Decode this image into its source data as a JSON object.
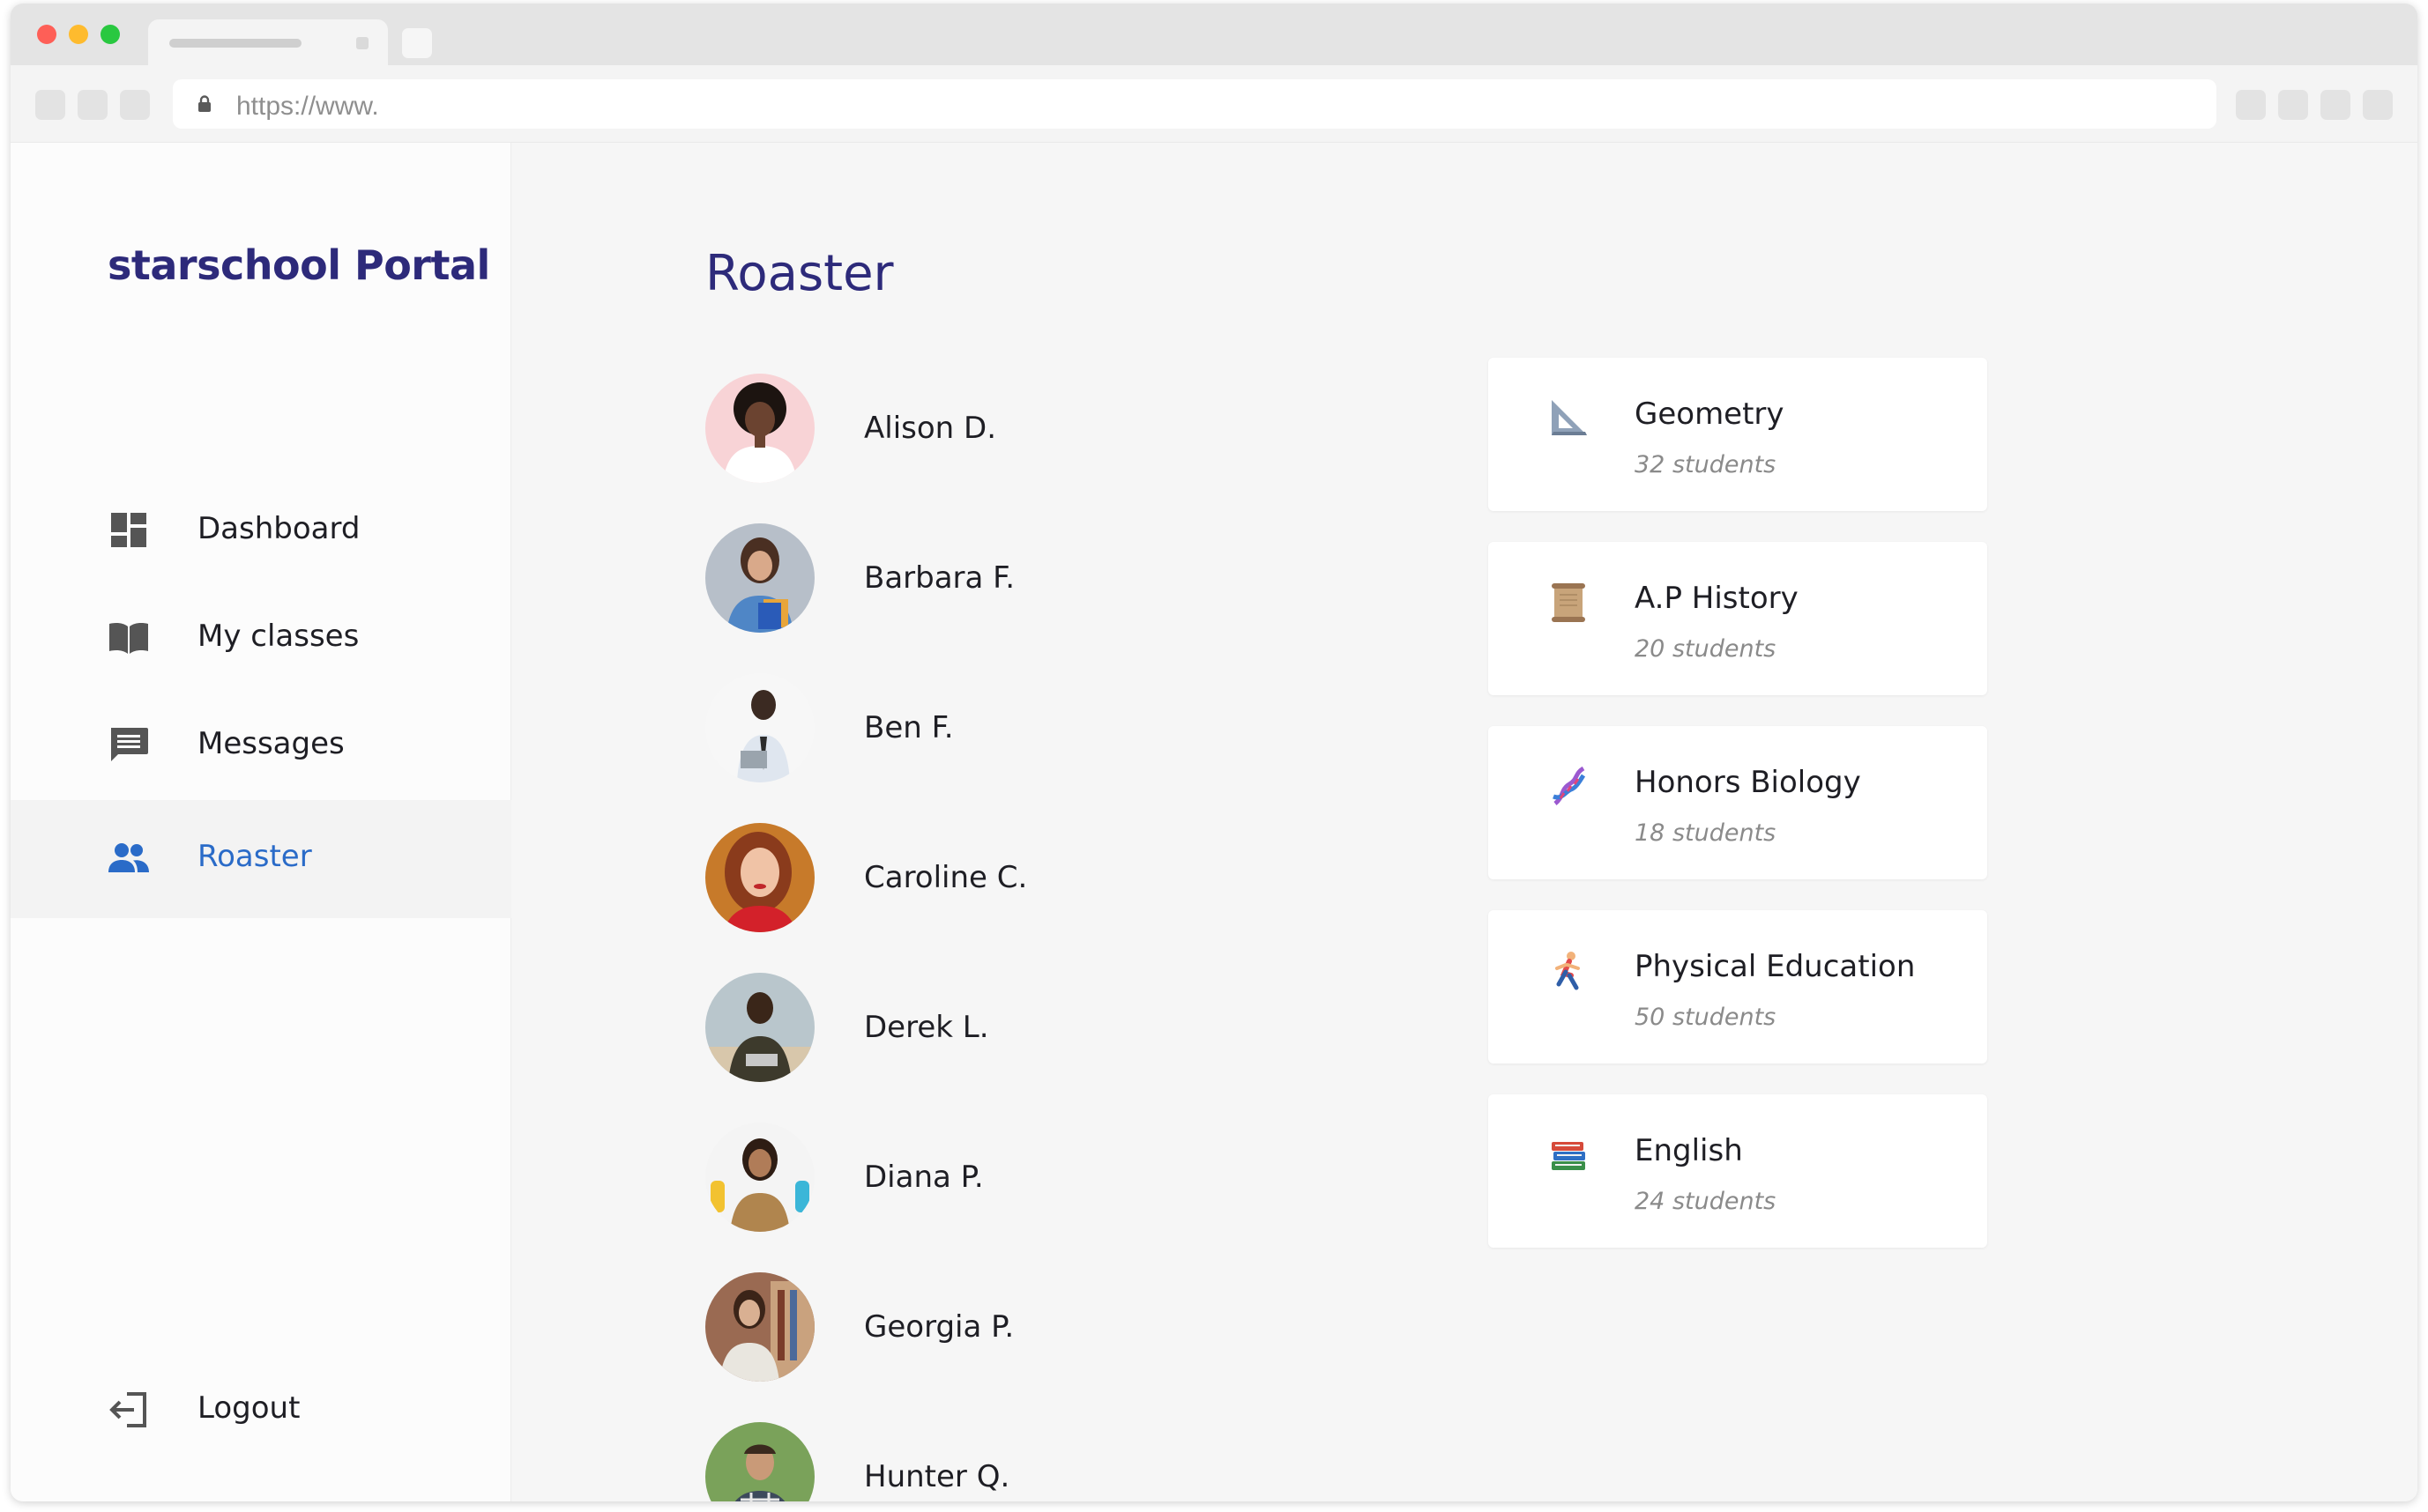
{
  "browser": {
    "url": "https://www."
  },
  "sidebar": {
    "brand": "starschool Portal",
    "items": [
      {
        "label": "Dashboard",
        "icon": "dashboard-icon",
        "active": false
      },
      {
        "label": "My classes",
        "icon": "book-icon",
        "active": false
      },
      {
        "label": "Messages",
        "icon": "message-icon",
        "active": false
      },
      {
        "label": "Roaster",
        "icon": "people-icon",
        "active": true
      }
    ],
    "logout": {
      "label": "Logout",
      "icon": "logout-icon"
    }
  },
  "main": {
    "title": "Roaster",
    "students": [
      {
        "name": "Alison D."
      },
      {
        "name": "Barbara F."
      },
      {
        "name": "Ben F."
      },
      {
        "name": "Caroline C."
      },
      {
        "name": "Derek L."
      },
      {
        "name": "Diana P."
      },
      {
        "name": "Georgia P."
      },
      {
        "name": "Hunter Q."
      }
    ],
    "classes": [
      {
        "name": "Geometry",
        "count": "32 students",
        "icon": "triangle-ruler-icon"
      },
      {
        "name": "A.P History",
        "count": "20 students",
        "icon": "scroll-icon"
      },
      {
        "name": "Honors Biology",
        "count": "18 students",
        "icon": "dna-icon"
      },
      {
        "name": "Physical Education",
        "count": "50 students",
        "icon": "runner-icon"
      },
      {
        "name": "English",
        "count": "24 students",
        "icon": "books-icon"
      }
    ]
  },
  "colors": {
    "brand": "#2d2a7a",
    "active_nav": "#2a6bc8",
    "muted_text": "#8a8a8a"
  }
}
